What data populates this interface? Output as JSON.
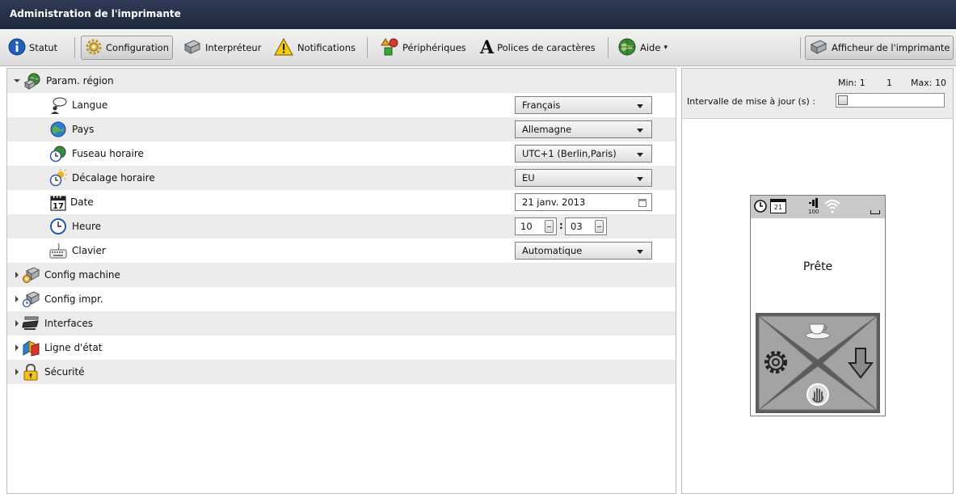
{
  "window": {
    "title": "Administration de l'imprimante"
  },
  "toolbar": {
    "status": "Statut",
    "configuration": "Configuration",
    "interpreter": "Interpréteur",
    "notifications": "Notifications",
    "peripherals": "Périphériques",
    "fonts": "Polices de caractères",
    "help": "Aide",
    "help_caret": "▾",
    "printer_display": "Afficheur de l'imprimante"
  },
  "tree": {
    "region": {
      "label": "Param. région",
      "language": {
        "label": "Langue",
        "value": "Français"
      },
      "country": {
        "label": "Pays",
        "value": "Allemagne"
      },
      "timezone": {
        "label": "Fuseau horaire",
        "value": "UTC+1 (Berlin,Paris)"
      },
      "time_offset": {
        "label": "Décalage horaire",
        "value": "EU"
      },
      "date": {
        "label": "Date",
        "value": "21 janv. 2013"
      },
      "time": {
        "label": "Heure",
        "hours": "10",
        "minutes": "03",
        "separator": ":"
      },
      "keyboard": {
        "label": "Clavier",
        "value": "Automatique"
      }
    },
    "groups": [
      {
        "label": "Config machine"
      },
      {
        "label": "Config impr."
      },
      {
        "label": "Interfaces"
      },
      {
        "label": "Ligne d'état"
      },
      {
        "label": "Sécurité"
      }
    ]
  },
  "refresh": {
    "min_label": "Min: 1",
    "current": "1",
    "max_label": "Max: 10",
    "label": "Intervalle de mise à jour (s) :",
    "slider_fraction": 0
  },
  "display": {
    "status_text": "Prête",
    "calendar_day": "21",
    "level_text": "100"
  },
  "colors": {
    "titlebar": "#243049",
    "shade": "#ececec",
    "info_blue": "#1f5fb8",
    "warning_yellow": "#f5cf12"
  }
}
